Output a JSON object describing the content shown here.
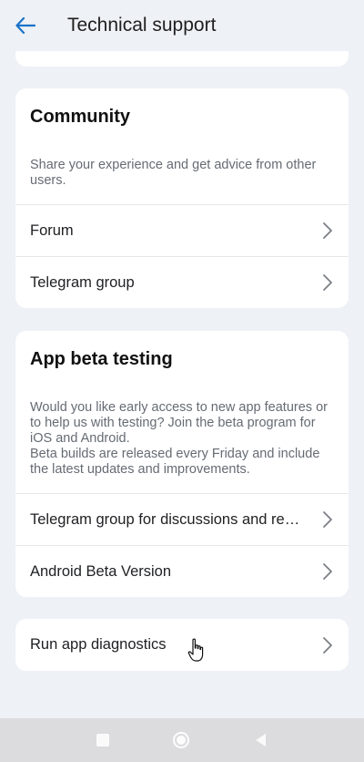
{
  "header": {
    "title": "Technical support",
    "back_icon": "arrow-left-icon"
  },
  "community": {
    "title": "Community",
    "description": "Share your experience and get advice from other users.",
    "items": [
      {
        "label": "Forum"
      },
      {
        "label": "Telegram group"
      }
    ]
  },
  "beta": {
    "title": "App beta testing",
    "description_1": "Would you like early access to new app features or to help us with testing? Join the beta program for iOS and Android.",
    "description_2": "Beta builds are released every Friday and include the latest updates and improvements.",
    "items": [
      {
        "label": "Telegram group for discussions and reports"
      },
      {
        "label": "Android Beta Version"
      }
    ]
  },
  "diagnostics": {
    "label": "Run app diagnostics"
  },
  "colors": {
    "accent": "#1a73c9",
    "background": "#eef1f5",
    "card": "#ffffff"
  },
  "navbar": {
    "items": [
      "square-icon",
      "circle-icon",
      "triangle-back-icon"
    ]
  }
}
